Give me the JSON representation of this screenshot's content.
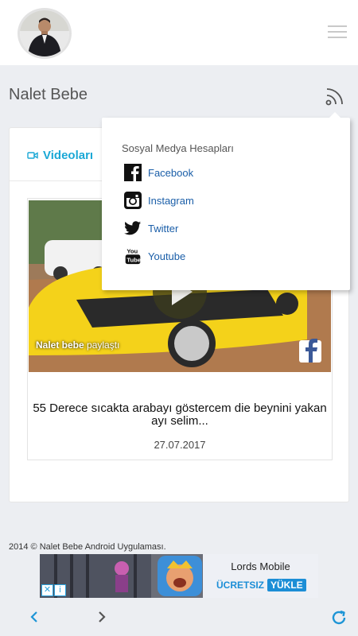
{
  "header": {
    "avatar_icon": "profile-photo",
    "menu_icon": "hamburger-icon"
  },
  "page": {
    "title": "Nalet Bebe",
    "feed_icon": "rss-icon"
  },
  "tabs": {
    "videos_label": "Videoları",
    "videos_icon": "video-camera-icon"
  },
  "video": {
    "overlay_name": "Nalet bebe",
    "overlay_action": "paylaştı",
    "title": "55 Derece sıcakta arabayı göstercem die beynini yakan ayı selim...",
    "date": "27.07.2017"
  },
  "dropdown": {
    "header": "Sosyal Medya Hesapları",
    "items": [
      {
        "label": "Facebook",
        "icon": "facebook-icon"
      },
      {
        "label": "Instagram",
        "icon": "instagram-icon"
      },
      {
        "label": "Twitter",
        "icon": "twitter-icon"
      },
      {
        "label": "Youtube",
        "icon": "youtube-icon"
      }
    ]
  },
  "footer": {
    "copyright": "2014 © Nalet Bebe Android Uygulaması."
  },
  "ad": {
    "title": "Lords Mobile",
    "cta_free": "ÜCRETSIZ",
    "cta_install": "YÜKLE",
    "close_x": "✕",
    "info": "i"
  },
  "colors": {
    "accent": "#1ba8d6",
    "link": "#1a5ea8",
    "background": "#eceef2",
    "nav": "#1e95d6"
  }
}
